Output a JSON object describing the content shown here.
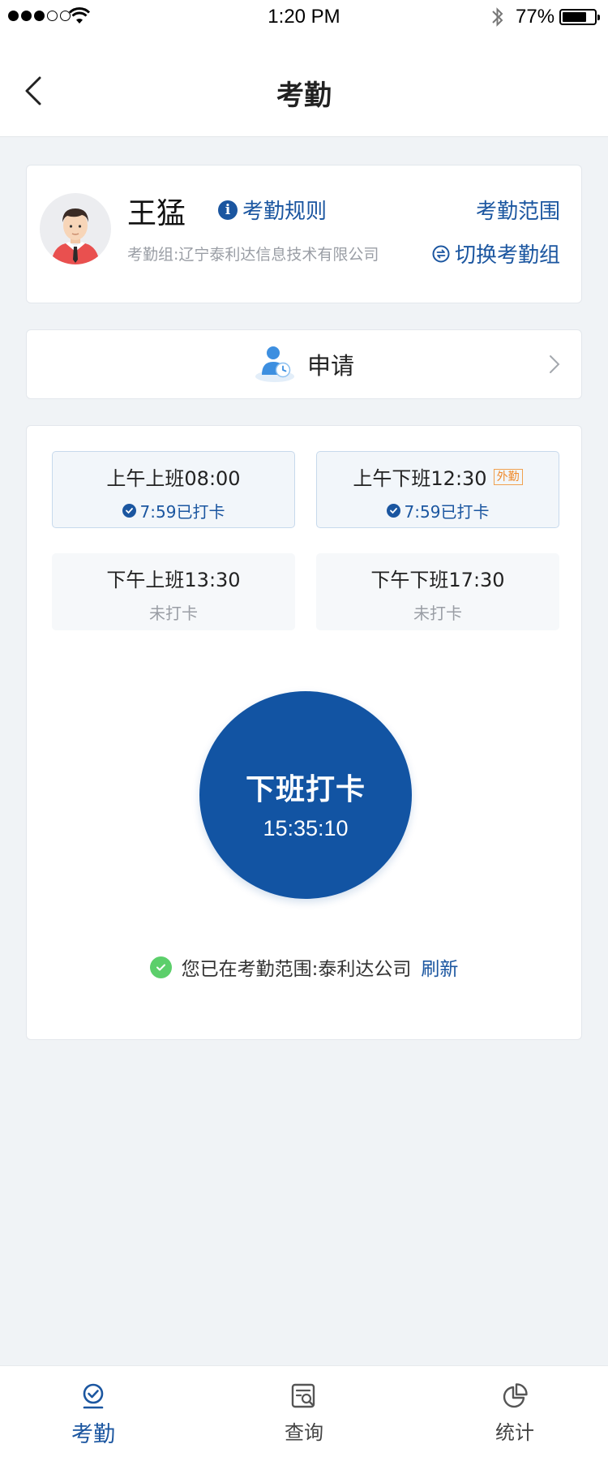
{
  "status_bar": {
    "time": "1:20 PM",
    "battery": "77%",
    "battery_level": 0.77
  },
  "nav": {
    "title": "考勤"
  },
  "profile": {
    "name": "王猛",
    "rules_label": "考勤规则",
    "range_label": "考勤范围",
    "group_text": "考勤组:辽宁泰利达信息技术有限公司",
    "switch_label": "切换考勤组"
  },
  "apply": {
    "label": "申请"
  },
  "slots": [
    {
      "title": "上午上班08:00",
      "status": "7:59已打卡",
      "checked": true,
      "tag": ""
    },
    {
      "title": "上午下班12:30",
      "status": "7:59已打卡",
      "checked": true,
      "tag": "外勤"
    },
    {
      "title": "下午上班13:30",
      "status": "未打卡",
      "checked": false,
      "tag": ""
    },
    {
      "title": "下午下班17:30",
      "status": "未打卡",
      "checked": false,
      "tag": ""
    }
  ],
  "punch": {
    "label": "下班打卡",
    "time": "15:35:10"
  },
  "location": {
    "text": "您已在考勤范围:泰利达公司",
    "refresh_label": "刷新"
  },
  "tabs": [
    {
      "label": "考勤",
      "icon": "attendance-icon",
      "active": true
    },
    {
      "label": "查询",
      "icon": "query-icon",
      "active": false
    },
    {
      "label": "统计",
      "icon": "stats-icon",
      "active": false
    }
  ],
  "colors": {
    "primary": "#1254a3",
    "link": "#1b56a0",
    "success": "#5ccf6b",
    "tag": "#f08b2c"
  }
}
